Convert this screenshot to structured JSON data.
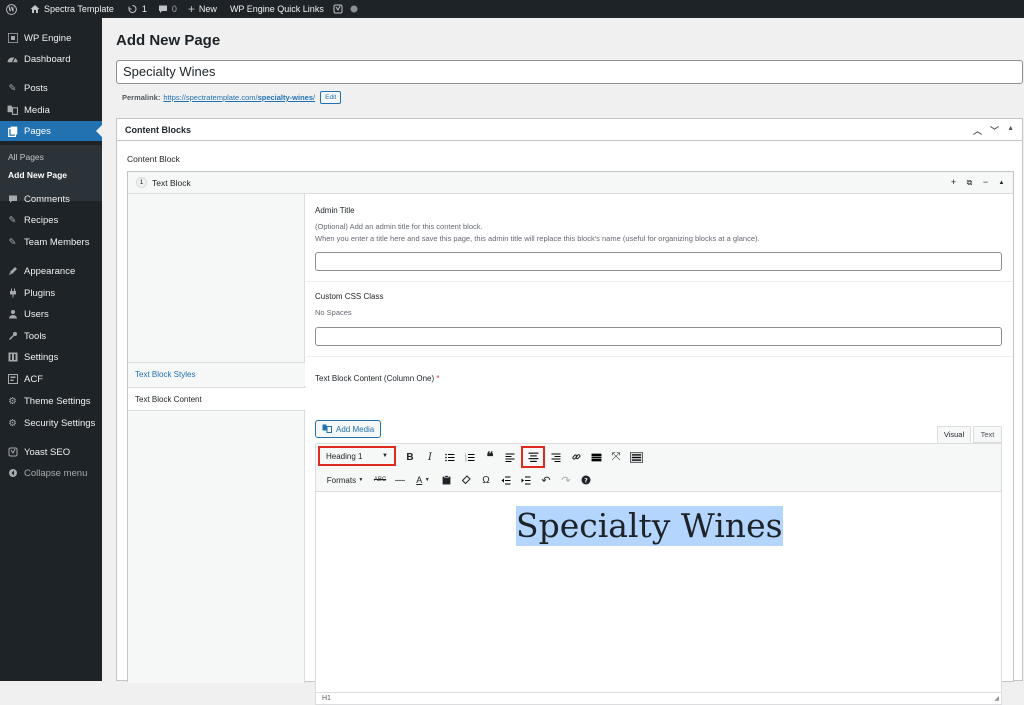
{
  "admin_bar": {
    "site_name": "Spectra Template",
    "updates_count": "1",
    "comments_count": "0",
    "new_label": "New",
    "quick_links_label": "WP Engine Quick Links"
  },
  "sidebar": {
    "items": [
      {
        "label": "WP Engine",
        "icon": "wpengine-icon"
      },
      {
        "label": "Dashboard",
        "icon": "dashboard-icon"
      },
      {
        "label": "Posts",
        "icon": "pin-icon"
      },
      {
        "label": "Media",
        "icon": "media-icon"
      },
      {
        "label": "Pages",
        "icon": "pages-icon"
      },
      {
        "label": "Comments",
        "icon": "comment-icon"
      },
      {
        "label": "Recipes",
        "icon": "pin-icon"
      },
      {
        "label": "Team Members",
        "icon": "pin-icon"
      },
      {
        "label": "Appearance",
        "icon": "brush-icon"
      },
      {
        "label": "Plugins",
        "icon": "plug-icon"
      },
      {
        "label": "Users",
        "icon": "user-icon"
      },
      {
        "label": "Tools",
        "icon": "wrench-icon"
      },
      {
        "label": "Settings",
        "icon": "settings-icon"
      },
      {
        "label": "ACF",
        "icon": "acf-icon"
      },
      {
        "label": "Theme Settings",
        "icon": "gear-icon"
      },
      {
        "label": "Security Settings",
        "icon": "gear-icon"
      },
      {
        "label": "Yoast SEO",
        "icon": "yoast-icon"
      },
      {
        "label": "Collapse menu",
        "icon": "collapse-icon"
      }
    ],
    "submenu": [
      "All Pages",
      "Add New Page"
    ]
  },
  "page": {
    "heading": "Add New Page",
    "post_title": "Specialty Wines",
    "permalink_label": "Permalink:",
    "permalink_base": "https://spectratemplate.com/",
    "permalink_slug": "specialty-wines",
    "permalink_trail": "/",
    "edit_label": "Edit"
  },
  "content_blocks": {
    "box_title": "Content Blocks",
    "field_label": "Content Block",
    "layout_order": "1",
    "layout_name": "Text Block",
    "tabs": [
      "Text Block Styles",
      "Text Block Content"
    ],
    "admin_title_label": "Admin Title",
    "admin_title_desc1": "(Optional) Add an admin title for this content block.",
    "admin_title_desc2": "When you enter a title here and save this page, this admin title will replace this block's name (useful for organizing blocks at a glance).",
    "css_class_label": "Custom CSS Class",
    "css_class_desc": "No Spaces",
    "content_label": "Text Block Content (Column One)",
    "required_mark": "*"
  },
  "editor": {
    "add_media_label": "Add Media",
    "visual_tab": "Visual",
    "text_tab": "Text",
    "format_value": "Heading 1",
    "formats_label": "Formats",
    "content_text": "Specialty Wines",
    "path_status": "H1"
  }
}
